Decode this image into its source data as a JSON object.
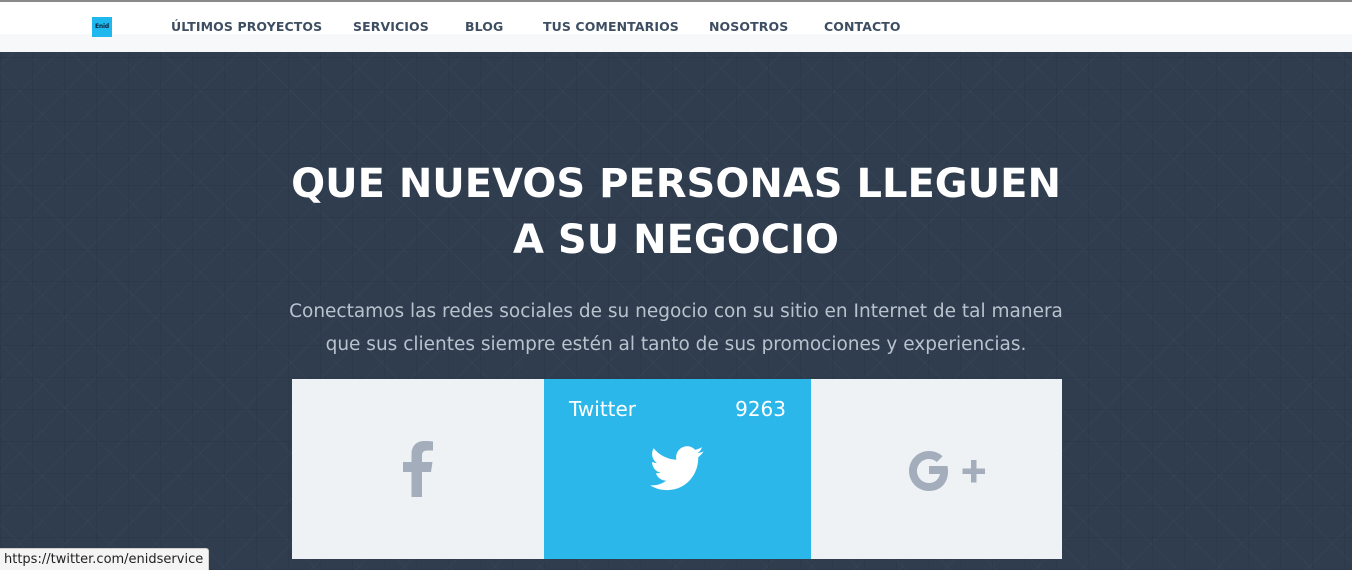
{
  "nav": {
    "logo_text": "Enid",
    "items": [
      {
        "label": "ÚLTIMOS PROYECTOS"
      },
      {
        "label": "SERVICIOS"
      },
      {
        "label": "BLOG"
      },
      {
        "label": "TUS COMENTARIOS"
      },
      {
        "label": "NOSOTROS"
      },
      {
        "label": "CONTACTO"
      }
    ]
  },
  "hero": {
    "title_line1": "QUE NUEVOS PERSONAS LLEGUEN",
    "title_line2": "A SU NEGOCIO",
    "subtitle_line1": "Conectamos las redes sociales de su negocio con su sitio en Internet de tal manera",
    "subtitle_line2": "que sus clientes siempre estén al tanto de sus promociones y experiencias."
  },
  "social": {
    "facebook": {
      "icon": "facebook-icon"
    },
    "twitter": {
      "label": "Twitter",
      "count": "9263",
      "icon": "twitter-bird-icon"
    },
    "google": {
      "icon": "google-plus-icon"
    }
  },
  "status_bar": {
    "url": "https://twitter.com/enidservice"
  },
  "colors": {
    "hero_bg": "#2f3d4f",
    "twitter_blue": "#2cb7ea",
    "card_bg": "#eef2f5",
    "icon_gray": "#a3adbb",
    "nav_text": "#3e4e62",
    "logo_bg": "#1eb7ee"
  }
}
